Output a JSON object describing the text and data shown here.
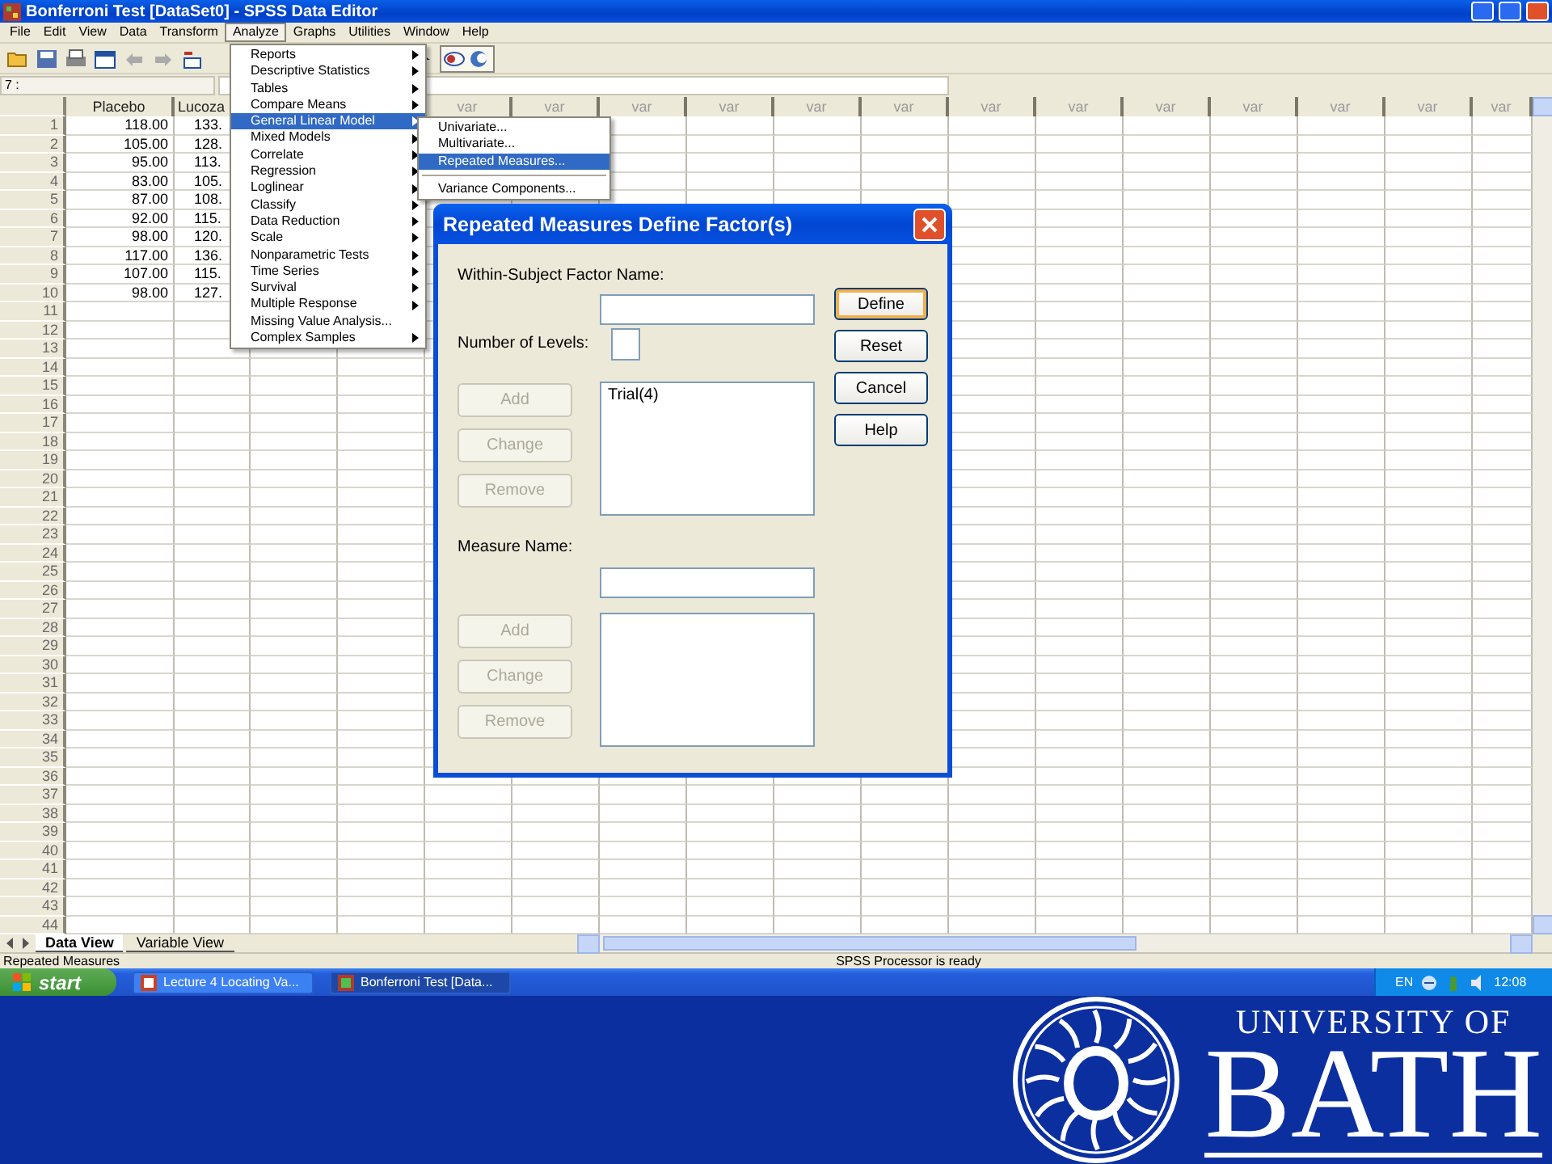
{
  "window": {
    "title": "Bonferroni Test [DataSet0] - SPSS Data Editor"
  },
  "menu_bar": [
    {
      "label": "File",
      "selected": false
    },
    {
      "label": "Edit",
      "selected": false
    },
    {
      "label": "View",
      "selected": false
    },
    {
      "label": "Data",
      "selected": false
    },
    {
      "label": "Transform",
      "selected": false
    },
    {
      "label": "Analyze",
      "selected": true
    },
    {
      "label": "Graphs",
      "selected": false
    },
    {
      "label": "Utilities",
      "selected": false
    },
    {
      "label": "Window",
      "selected": false
    },
    {
      "label": "Help",
      "selected": false
    }
  ],
  "cell_editor": {
    "cell": "7 :"
  },
  "grid": {
    "columns": [
      {
        "label": "Placebo"
      },
      {
        "label": "Lucoza"
      },
      {},
      {},
      {
        "label": "var"
      },
      {
        "label": "var"
      },
      {
        "label": "var"
      },
      {
        "label": "var"
      },
      {
        "label": "var"
      },
      {
        "label": "var"
      },
      {
        "label": "var"
      },
      {
        "label": "var"
      },
      {
        "label": "var"
      },
      {
        "label": "var"
      },
      {
        "label": "var"
      },
      {
        "label": "var"
      },
      {
        "label": "var"
      }
    ],
    "rows": [
      {
        "number": "1",
        "cells": [
          "118.00",
          "133."
        ]
      },
      {
        "number": "2",
        "cells": [
          "105.00",
          "128."
        ]
      },
      {
        "number": "3",
        "cells": [
          "95.00",
          "113."
        ]
      },
      {
        "number": "4",
        "cells": [
          "83.00",
          "105."
        ]
      },
      {
        "number": "5",
        "cells": [
          "87.00",
          "108."
        ]
      },
      {
        "number": "6",
        "cells": [
          "92.00",
          "115."
        ]
      },
      {
        "number": "7",
        "cells": [
          "98.00",
          "120."
        ]
      },
      {
        "number": "8",
        "cells": [
          "117.00",
          "136."
        ]
      },
      {
        "number": "9",
        "cells": [
          "107.00",
          "115."
        ]
      },
      {
        "number": "10",
        "cells": [
          "98.00",
          "127."
        ]
      },
      {
        "number": "11"
      },
      {
        "number": "12"
      },
      {
        "number": "13"
      },
      {
        "number": "14"
      },
      {
        "number": "15"
      },
      {
        "number": "16"
      },
      {
        "number": "17"
      },
      {
        "number": "18"
      },
      {
        "number": "19"
      },
      {
        "number": "20"
      },
      {
        "number": "21"
      },
      {
        "number": "22"
      },
      {
        "number": "23"
      },
      {
        "number": "24"
      },
      {
        "number": "25"
      },
      {
        "number": "26"
      },
      {
        "number": "27"
      },
      {
        "number": "28"
      },
      {
        "number": "29"
      },
      {
        "number": "30"
      },
      {
        "number": "31"
      },
      {
        "number": "32"
      },
      {
        "number": "33"
      },
      {
        "number": "34"
      },
      {
        "number": "35"
      },
      {
        "number": "36"
      },
      {
        "number": "37"
      },
      {
        "number": "38"
      },
      {
        "number": "39"
      },
      {
        "number": "40"
      },
      {
        "number": "41"
      },
      {
        "number": "42"
      },
      {
        "number": "43"
      },
      {
        "number": "44"
      }
    ]
  },
  "analyze_menu": {
    "items": [
      {
        "label": "Reports",
        "has_submenu": true,
        "selected": false
      },
      {
        "label": "Descriptive Statistics",
        "has_submenu": true,
        "selected": false
      },
      {
        "label": "Tables",
        "has_submenu": true,
        "selected": false
      },
      {
        "label": "Compare Means",
        "has_submenu": true,
        "selected": false
      },
      {
        "label": "General Linear Model",
        "has_submenu": true,
        "selected": true
      },
      {
        "label": "Mixed Models",
        "has_submenu": true,
        "selected": false
      },
      {
        "label": "Correlate",
        "has_submenu": true,
        "selected": false
      },
      {
        "label": "Regression",
        "has_submenu": true,
        "selected": false
      },
      {
        "label": "Loglinear",
        "has_submenu": true,
        "selected": false
      },
      {
        "label": "Classify",
        "has_submenu": true,
        "selected": false
      },
      {
        "label": "Data Reduction",
        "has_submenu": true,
        "selected": false
      },
      {
        "label": "Scale",
        "has_submenu": true,
        "selected": false
      },
      {
        "label": "Nonparametric Tests",
        "has_submenu": true,
        "selected": false
      },
      {
        "label": "Time Series",
        "has_submenu": true,
        "selected": false
      },
      {
        "label": "Survival",
        "has_submenu": true,
        "selected": false
      },
      {
        "label": "Multiple Response",
        "has_submenu": true,
        "selected": false
      },
      {
        "label": "Missing Value Analysis...",
        "has_submenu": false,
        "selected": false
      },
      {
        "label": "Complex Samples",
        "has_submenu": true,
        "selected": false
      }
    ]
  },
  "submenu": {
    "items": [
      {
        "kind": "item",
        "label": "Univariate...",
        "selected": false
      },
      {
        "kind": "item",
        "label": "Multivariate...",
        "selected": false
      },
      {
        "kind": "item",
        "label": "Repeated Measures...",
        "selected": true
      },
      {
        "kind": "separator"
      },
      {
        "kind": "item",
        "label": "Variance Components...",
        "selected": false
      }
    ]
  },
  "dialog": {
    "title": "Repeated Measures Define Factor(s)",
    "factor_label": "Within-Subject Factor Name:",
    "levels_label": "Number of Levels:",
    "factor_buttons": [
      {
        "label": "Add",
        "disabled": true
      },
      {
        "label": "Change",
        "disabled": true
      },
      {
        "label": "Remove",
        "disabled": true
      }
    ],
    "factor_list": [
      "Trial(4)"
    ],
    "measure_label": "Measure Name:",
    "measure_buttons": [
      {
        "label": "Add",
        "disabled": true
      },
      {
        "label": "Change",
        "disabled": true
      },
      {
        "label": "Remove",
        "disabled": true
      }
    ],
    "actions": [
      {
        "label": "Define",
        "focused": true
      },
      {
        "label": "Reset",
        "focused": false
      },
      {
        "label": "Cancel",
        "focused": false
      },
      {
        "label": "Help",
        "focused": false
      }
    ]
  },
  "sheet_tabs": [
    {
      "label": "Data View",
      "selected": true
    },
    {
      "label": "Variable View",
      "selected": false
    }
  ],
  "status_bar": {
    "message": "Repeated Measures",
    "processor": "SPSS Processor is ready"
  },
  "taskbar": {
    "start": "start",
    "tasks": [
      {
        "label": "Lecture 4 Locating Va...",
        "selected": false
      },
      {
        "label": "Bonferroni Test [Data...",
        "selected": true
      }
    ],
    "language": "EN",
    "clock": "12:08"
  },
  "banner": {
    "line1": "UNIVERSITY OF",
    "line2": "BATH"
  }
}
